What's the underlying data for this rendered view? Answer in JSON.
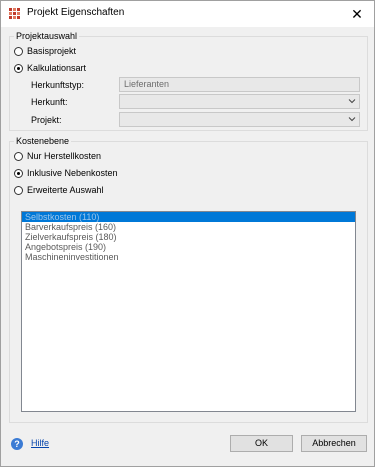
{
  "window": {
    "title": "Projekt Eigenschaften",
    "close_symbol": "✕"
  },
  "projektauswahl": {
    "legend": "Projektauswahl",
    "options": [
      {
        "label": "Basisprojekt",
        "checked": false
      },
      {
        "label": "Kalkulationsart",
        "checked": true
      }
    ],
    "fields": [
      {
        "label": "Herkunftstyp:",
        "value": "Lieferanten",
        "disabled": true
      },
      {
        "label": "Herkunft:",
        "value": "",
        "disabled": false
      },
      {
        "label": "Projekt:",
        "value": "",
        "disabled": false
      }
    ]
  },
  "kostenebene": {
    "legend": "Kostenebene",
    "options": [
      {
        "label": "Nur Herstellkosten",
        "checked": false
      },
      {
        "label": "Inklusive Nebenkosten",
        "checked": true
      },
      {
        "label": "Erweiterte Auswahl",
        "checked": false
      }
    ],
    "list": [
      {
        "label": "Selbstkosten (110)",
        "selected": true
      },
      {
        "label": "Barverkaufspreis (160)",
        "selected": false
      },
      {
        "label": "Zielverkaufspreis (180)",
        "selected": false
      },
      {
        "label": "Angebotspreis (190)",
        "selected": false
      },
      {
        "label": "Maschineninvestitionen",
        "selected": false
      }
    ]
  },
  "footer": {
    "help_label": "Hilfe",
    "ok_label": "OK",
    "cancel_label": "Abbrechen"
  },
  "colors": {
    "selection": "#0078d7",
    "link": "#0645ad"
  }
}
